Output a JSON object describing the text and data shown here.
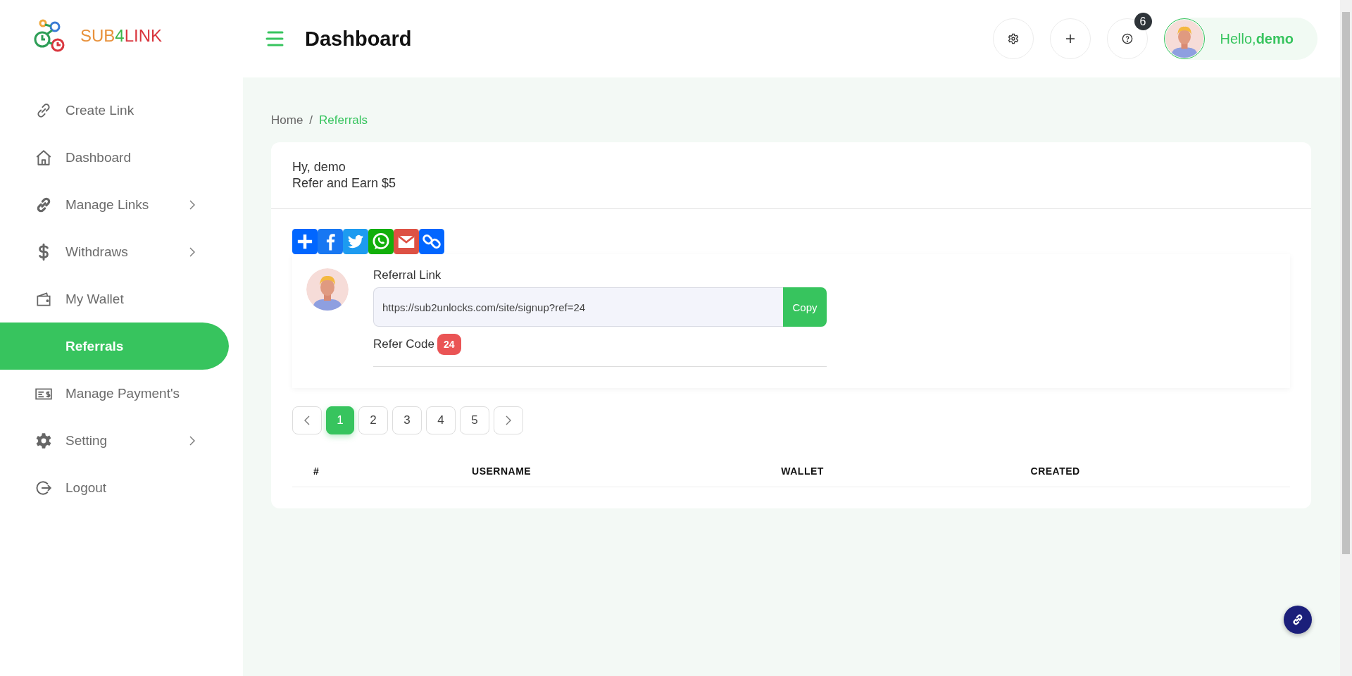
{
  "logo": {
    "parts": [
      {
        "text": "SUB",
        "color": "#e8913a"
      },
      {
        "text": "4",
        "color": "#3cb54a"
      },
      {
        "text": "LINK",
        "color": "#d9363e"
      }
    ]
  },
  "sidebar": {
    "items": [
      {
        "label": "Create Link",
        "has_submenu": false,
        "selected": false
      },
      {
        "label": "Dashboard",
        "has_submenu": false,
        "selected": false
      },
      {
        "label": "Manage Links",
        "has_submenu": true,
        "selected": false
      },
      {
        "label": "Withdraws",
        "has_submenu": true,
        "selected": false
      },
      {
        "label": "My Wallet",
        "has_submenu": false,
        "selected": false
      },
      {
        "label": "Referrals",
        "has_submenu": false,
        "selected": true
      },
      {
        "label": "Manage Payment's",
        "has_submenu": false,
        "selected": false
      },
      {
        "label": "Setting",
        "has_submenu": true,
        "selected": false
      },
      {
        "label": "Logout",
        "has_submenu": false,
        "selected": false
      }
    ]
  },
  "header": {
    "title": "Dashboard",
    "notification_count": "6",
    "greeting": "Hello,**demo**"
  },
  "breadcrumb": {
    "items": [
      {
        "label": "Home",
        "current": false
      },
      {
        "label": "Referrals",
        "current": true
      }
    ],
    "separator": "/"
  },
  "card": {
    "greeting": "Hy, demo",
    "headline": "Refer and Earn $5",
    "referral_link": {
      "label": "Referral Link",
      "value": "https://sub2unlocks.com/site/signup?ref=24",
      "button": "Copy"
    },
    "refer_code": {
      "label": "Refer Code",
      "value": "24"
    }
  },
  "pagination": {
    "pages": [
      {
        "label": "1",
        "selected": true
      },
      {
        "label": "2",
        "selected": false
      },
      {
        "label": "3",
        "selected": false
      },
      {
        "label": "4",
        "selected": false
      },
      {
        "label": "5",
        "selected": false
      }
    ]
  },
  "table": {
    "columns": [
      "#",
      "USERNAME",
      "WALLET",
      "CREATED"
    ]
  }
}
